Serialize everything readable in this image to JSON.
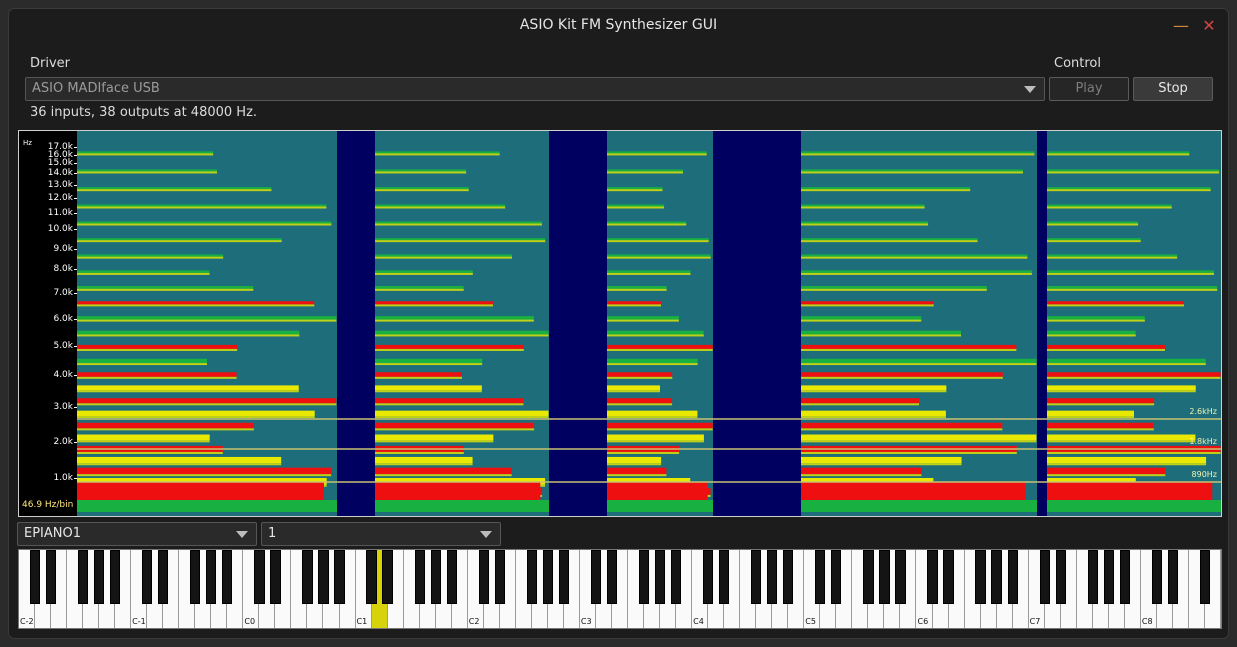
{
  "window": {
    "title": "ASIO Kit FM Synthesizer GUI"
  },
  "driver": {
    "label": "Driver",
    "selected": "ASIO MADIface USB",
    "info": "36 inputs, 38 outputs at 48000 Hz."
  },
  "control": {
    "label": "Control",
    "play_label": "Play",
    "stop_label": "Stop"
  },
  "spectrogram": {
    "unit_label": "Hz",
    "resolution_label": "46.9 Hz/bin",
    "freq_ticks": [
      "17.0k",
      "16.0k",
      "15.0k",
      "14.0k",
      "13.0k",
      "12.0k",
      "11.0k",
      "10.0k",
      "9.0k",
      "8.0k",
      "7.0k",
      "6.0k",
      "5.0k",
      "4.0k",
      "3.0k",
      "2.0k",
      "1.0k"
    ],
    "markers": [
      "2.6kHz",
      "1.8kHz",
      "890Hz"
    ],
    "colors": {
      "background": "#000060",
      "low": "#1d6e7a",
      "mid": "#18b040",
      "high": "#e8e800",
      "peak": "#ee1010",
      "marker": "#c8c070"
    }
  },
  "instrument": {
    "patch": "EPIANO1",
    "channel": "1"
  },
  "keyboard": {
    "octave_labels": [
      "C-2",
      "C-1",
      "C0",
      "C1",
      "C2",
      "C3",
      "C4",
      "C5",
      "C6",
      "C7",
      "C8"
    ],
    "active_key_color": "#d8d20a",
    "active_note": "D1"
  }
}
